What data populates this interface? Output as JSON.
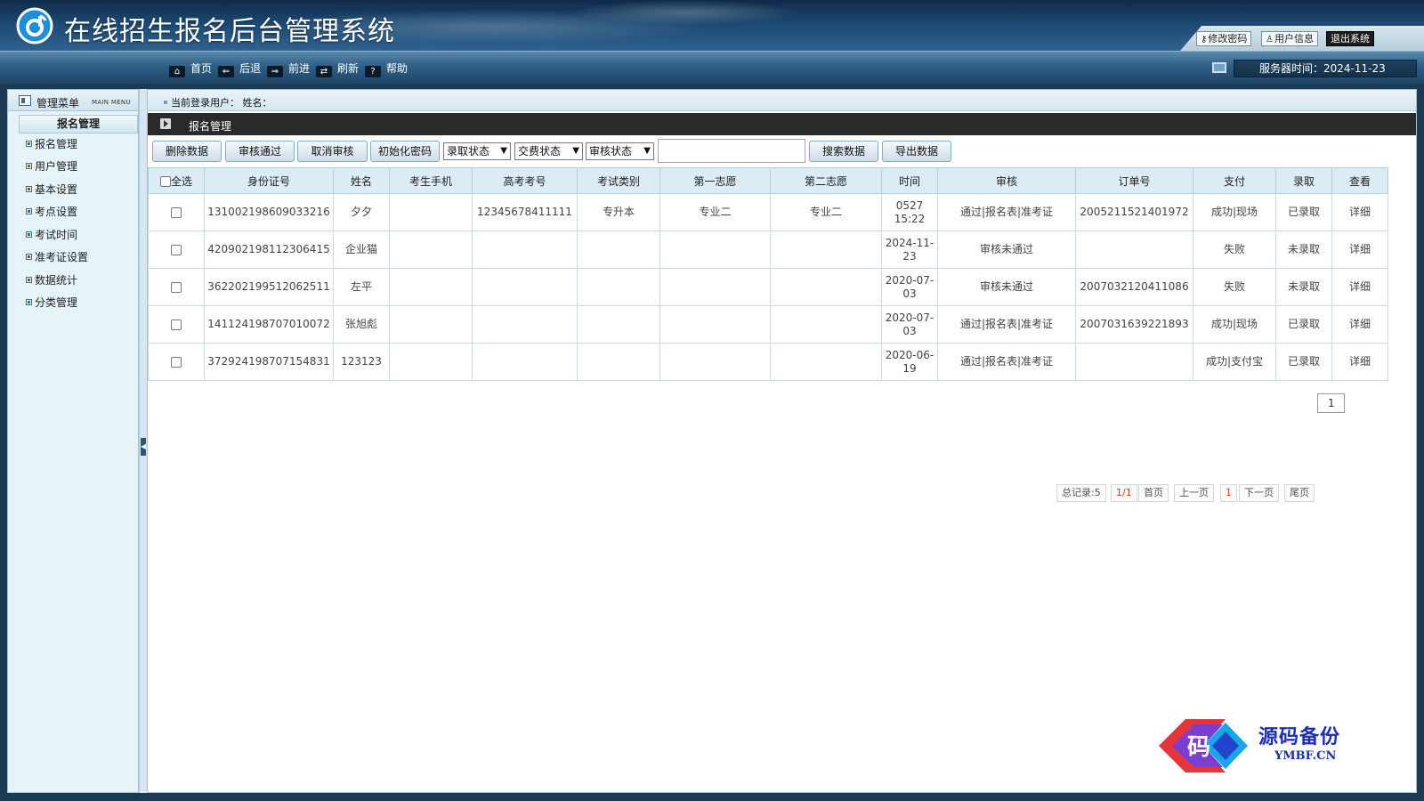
{
  "header": {
    "title": "在线招生报名后台管理系统",
    "links": [
      {
        "icon": "🔑",
        "label": "修改密码"
      },
      {
        "icon": "👤",
        "label": "用户信息"
      },
      {
        "label": "退出系统"
      }
    ]
  },
  "toolbar": {
    "items": [
      {
        "icon": "home-icon",
        "glyph": "⌂",
        "label": "首页"
      },
      {
        "icon": "back-icon",
        "glyph": "⇐",
        "label": "后退"
      },
      {
        "icon": "forward-icon",
        "glyph": "⇒",
        "label": "前进"
      },
      {
        "icon": "refresh-icon",
        "glyph": "⇄",
        "label": "刷新"
      },
      {
        "icon": "help-icon",
        "glyph": "?",
        "label": "帮助"
      }
    ],
    "server_time": "服务器时间：2024-11-23"
  },
  "sidebar": {
    "title": "管理菜单",
    "title_en": "MAIN MENU",
    "group": "报名管理",
    "items": [
      "报名管理",
      "用户管理",
      "基本设置",
      "考点设置",
      "考试时间",
      "准考证设置",
      "数据统计",
      "分类管理"
    ]
  },
  "userbar": {
    "text": "当前登录用户：  姓名："
  },
  "section": {
    "title": "报名管理"
  },
  "actions": {
    "delete": "删除数据",
    "approve": "审核通过",
    "cancel_approve": "取消审核",
    "init_password": "初始化密码",
    "select_admit": "录取状态",
    "select_fee": "交费状态",
    "select_review": "审核状态",
    "search": "搜索数据",
    "export": "导出数据"
  },
  "table": {
    "select_all": "全选",
    "headers": [
      "身份证号",
      "姓名",
      "考生手机",
      "高考考号",
      "考试类别",
      "第一志愿",
      "第二志愿",
      "时间",
      "审核",
      "订单号",
      "支付",
      "录取",
      "查看"
    ],
    "rows": [
      {
        "id": "131002198609033216",
        "name": "夕夕",
        "phone": "",
        "exam_no": "12345678411111",
        "category": "专升本",
        "choice1": "专业二",
        "choice2": "专业二",
        "time": "0527 15:22",
        "review": "通过|报名表|准考证",
        "review_ok": true,
        "order": "2005211521401972",
        "pay": "成功|现场",
        "pay_ok": true,
        "admit": "已录取",
        "admit_ok": true,
        "view": "详细"
      },
      {
        "id": "420902198112306415",
        "name": "企业猫",
        "phone": "",
        "exam_no": "",
        "category": "",
        "choice1": "",
        "choice2": "",
        "time": "2024-11-23",
        "review": "审核未通过",
        "review_ok": false,
        "order": "",
        "pay": "失败",
        "pay_ok": false,
        "admit": "未录取",
        "admit_ok": false,
        "view": "详细"
      },
      {
        "id": "362202199512062511",
        "name": "左平",
        "phone": "",
        "exam_no": "",
        "category": "",
        "choice1": "",
        "choice2": "",
        "time": "2020-07-03",
        "review": "审核未通过",
        "review_ok": false,
        "order": "2007032120411086",
        "pay": "失败",
        "pay_ok": false,
        "admit": "未录取",
        "admit_ok": false,
        "view": "详细"
      },
      {
        "id": "141124198707010072",
        "name": "张旭彪",
        "phone": "",
        "exam_no": "",
        "category": "",
        "choice1": "",
        "choice2": "",
        "time": "2020-07-03",
        "review": "通过|报名表|准考证",
        "review_ok": true,
        "order": "2007031639221893",
        "pay": "成功|现场",
        "pay_ok": true,
        "admit": "已录取",
        "admit_ok": true,
        "view": "详细"
      },
      {
        "id": "372924198707154831",
        "name": "123123",
        "phone": "",
        "exam_no": "",
        "category": "",
        "choice1": "",
        "choice2": "",
        "time": "2020-06-19",
        "review": "通过|报名表|准考证",
        "review_ok": true,
        "order": "",
        "pay": "成功|支付宝",
        "pay_ok": true,
        "admit": "已录取",
        "admit_ok": true,
        "view": "详细"
      }
    ]
  },
  "pagination": {
    "total": "总记录:5",
    "pages": "1/1",
    "first": "首页",
    "prev": "上一页",
    "current": "1",
    "next": "下一页",
    "last": "尾页",
    "input_value": "1"
  },
  "watermark": {
    "logo_char": "码",
    "zh": "源码备份",
    "en": "YMBF.CN"
  }
}
